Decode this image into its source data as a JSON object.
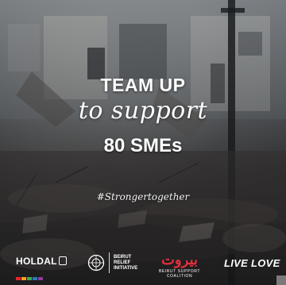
{
  "headline": {
    "line1": "TEAM UP",
    "line2": "to support",
    "line3": "80 SMEs"
  },
  "hashtag": "#Strongertogether",
  "logos": {
    "holdal": "HOLDAL",
    "bri_line1": "BEIRUT",
    "bri_line2": "RELIEF",
    "bri_line3": "INITIATIVE",
    "bsc_script": "بيروت",
    "bsc_caption": "BEIRUT SUPPORT COALITION",
    "livelove": "LIVE LOVE"
  },
  "colors": {
    "text": "#ffffff",
    "accent_red": "#e0303c"
  }
}
